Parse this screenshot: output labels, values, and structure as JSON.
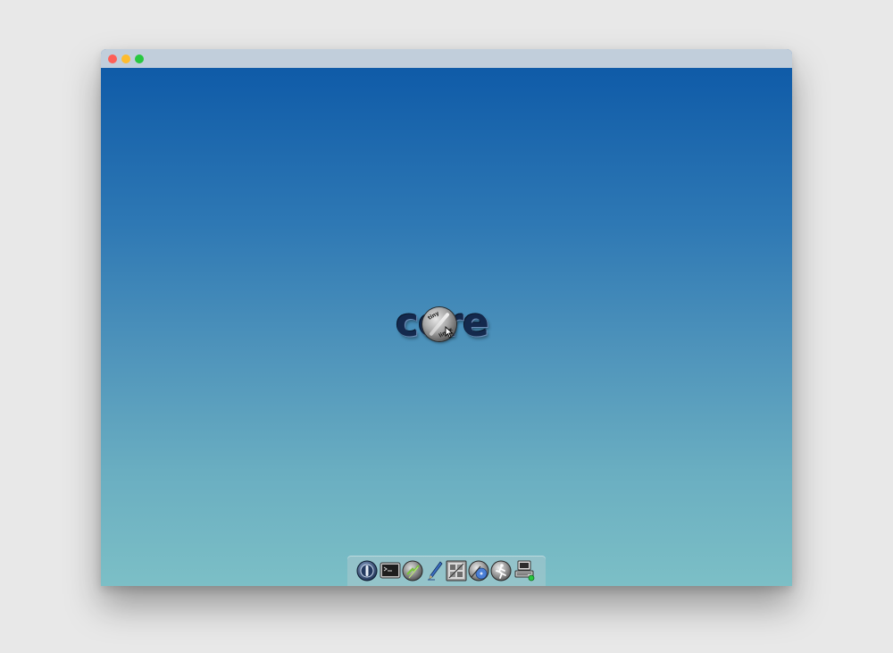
{
  "window": {
    "controls": [
      "close",
      "minimize",
      "maximize"
    ]
  },
  "desktop": {
    "logo": {
      "text": "core",
      "disc_text_top": "tiny",
      "disc_text_bottom": "linux"
    }
  },
  "dock": {
    "items": [
      {
        "name": "exit-icon",
        "label": ""
      },
      {
        "name": "terminal-icon",
        "label": ""
      },
      {
        "name": "apps-icon",
        "label": ""
      },
      {
        "name": "editor-icon",
        "label": ""
      },
      {
        "name": "control-panel-icon",
        "label": ""
      },
      {
        "name": "mount-tool-icon",
        "label": ""
      },
      {
        "name": "run-icon",
        "label": ""
      },
      {
        "name": "network-icon",
        "label": ""
      }
    ]
  },
  "colors": {
    "desktop_top": "#0f5ba8",
    "desktop_bottom": "#7cbfc6",
    "titlebar": "#c1cedb",
    "logo_text": "#14294d"
  }
}
